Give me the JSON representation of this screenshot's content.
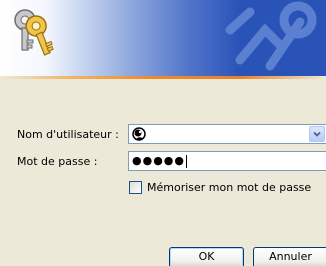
{
  "banner": {
    "icon": "keys-icon",
    "watermark": "keys-watermark",
    "gradient_colors": [
      "#ffffff",
      "#2a53b8"
    ],
    "stripe_color": "#ea8b31"
  },
  "form": {
    "username_label": "Nom d'utilisateur :",
    "username_icon": "user-icon",
    "password_label": "Mot de passe :",
    "password_value": "●●●●●",
    "remember_label": "Mémoriser mon mot de passe",
    "remember_checked": false
  },
  "buttons": {
    "ok_label": "OK",
    "cancel_label": "Annuler"
  }
}
